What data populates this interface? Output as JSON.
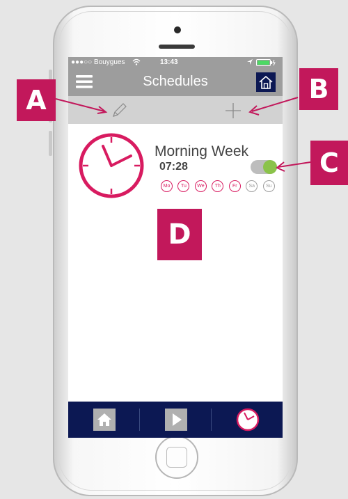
{
  "status_bar": {
    "carrier": "●●●○○ Bouygues",
    "time": "13:43"
  },
  "header": {
    "title": "Schedules"
  },
  "toolbar": {
    "edit_icon": "pencil-icon",
    "add_icon": "plus-icon"
  },
  "schedule": {
    "name": "Morning Week",
    "time": "07:28",
    "enabled": true,
    "days": [
      {
        "label": "Mo",
        "active": true
      },
      {
        "label": "Tu",
        "active": true
      },
      {
        "label": "We",
        "active": true
      },
      {
        "label": "Th",
        "active": true
      },
      {
        "label": "Fr",
        "active": true
      },
      {
        "label": "Sa",
        "active": false
      },
      {
        "label": "Su",
        "active": false
      }
    ]
  },
  "tabs": [
    {
      "icon": "home-icon"
    },
    {
      "icon": "play-icon"
    },
    {
      "icon": "clock-icon",
      "active": true
    }
  ],
  "callouts": {
    "a": "A",
    "b": "B",
    "c": "C",
    "d": "D"
  },
  "colors": {
    "accent": "#d81b60",
    "callout": "#c2185b",
    "tabbar": "#0c1853",
    "toggle_on": "#8bc34a"
  }
}
